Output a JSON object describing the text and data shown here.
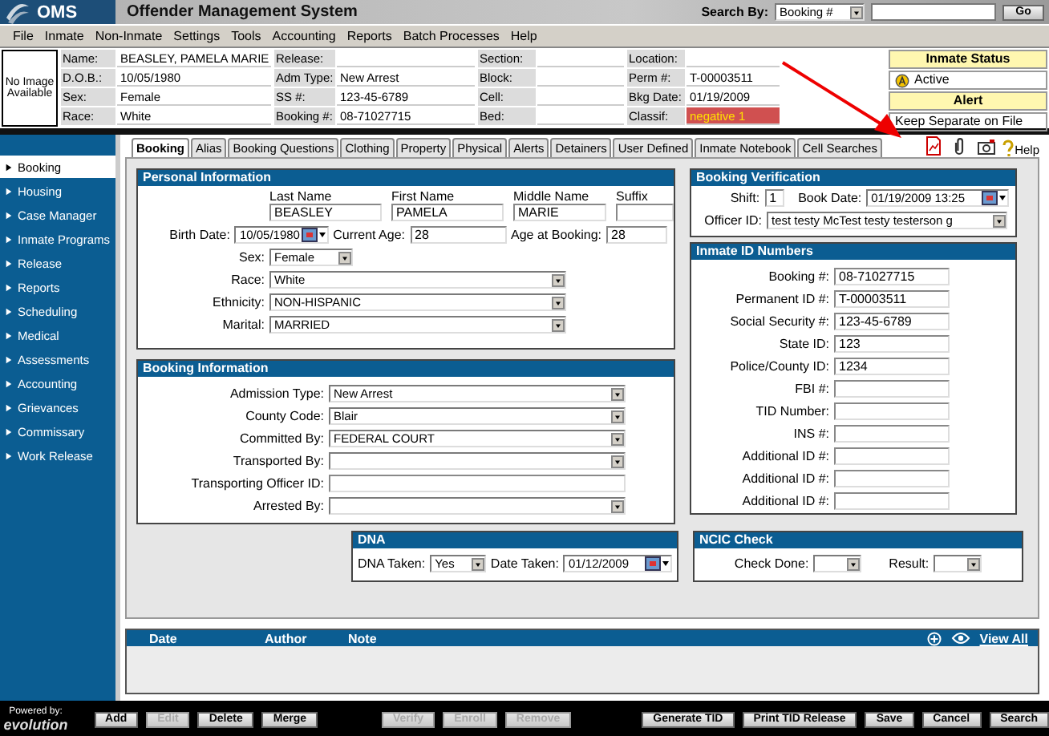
{
  "app": {
    "logo": "OMS",
    "title": "Offender Management System"
  },
  "search": {
    "label": "Search By:",
    "option": "Booking #",
    "button": "Go"
  },
  "menu": [
    "File",
    "Inmate",
    "Non-Inmate",
    "Settings",
    "Tools",
    "Accounting",
    "Reports",
    "Batch Processes",
    "Help"
  ],
  "inmate_header": {
    "photo_text": "No Image Available",
    "columns": [
      [
        {
          "label": "Name:",
          "value": "BEASLEY, PAMELA MARIE",
          "flagged": false
        },
        {
          "label": "D.O.B.:",
          "value": "10/05/1980",
          "flagged": false
        },
        {
          "label": "Sex:",
          "value": "Female",
          "flagged": false
        },
        {
          "label": "Race:",
          "value": "White",
          "flagged": false
        }
      ],
      [
        {
          "label": "Release:",
          "flagged": false
        },
        {
          "label": "Adm Type:",
          "value": "New Arrest",
          "flagged": false
        },
        {
          "label": "SS #:",
          "value": "123-45-6789",
          "flagged": false
        },
        {
          "label": "Booking #:",
          "value": "08-71027715",
          "flagged": false
        }
      ],
      [
        {
          "label": "Section:",
          "flagged": false
        },
        {
          "label": "Block:",
          "flagged": false
        },
        {
          "label": "Cell:",
          "flagged": false
        },
        {
          "label": "Bed:",
          "flagged": false
        }
      ],
      [
        {
          "label": "Location:",
          "flagged": false
        },
        {
          "label": "Perm #:",
          "value": "T-00003511",
          "flagged": false
        },
        {
          "label": "Bkg Date:",
          "value": "01/19/2009",
          "flagged": false
        },
        {
          "label": "Classif:",
          "value": "negative 1",
          "flagged": true
        }
      ]
    ]
  },
  "status_panel": {
    "title": "Inmate Status",
    "status": "Active",
    "alert_title": "Alert",
    "alert": "Keep Separate on File"
  },
  "sidebar": [
    {
      "label": "Booking",
      "selected": true
    },
    {
      "label": "Housing",
      "selected": false
    },
    {
      "label": "Case Manager",
      "selected": false
    },
    {
      "label": "Inmate Programs",
      "selected": false
    },
    {
      "label": "Release",
      "selected": false
    },
    {
      "label": "Reports",
      "selected": false
    },
    {
      "label": "Scheduling",
      "selected": false
    },
    {
      "label": "Medical",
      "selected": false
    },
    {
      "label": "Assessments",
      "selected": false
    },
    {
      "label": "Accounting",
      "selected": false
    },
    {
      "label": "Grievances",
      "selected": false
    },
    {
      "label": "Commissary",
      "selected": false
    },
    {
      "label": "Work Release",
      "selected": false
    }
  ],
  "tabs": [
    {
      "label": "Booking",
      "selected": true
    },
    {
      "label": "Alias",
      "selected": false
    },
    {
      "label": "Booking Questions",
      "selected": false
    },
    {
      "label": "Clothing",
      "selected": false
    },
    {
      "label": "Property",
      "selected": false
    },
    {
      "label": "Physical",
      "selected": false
    },
    {
      "label": "Alerts",
      "selected": false
    },
    {
      "label": "Detainers",
      "selected": false
    },
    {
      "label": "User Defined",
      "selected": false
    },
    {
      "label": "Inmate Notebook",
      "selected": false
    },
    {
      "label": "Cell Searches",
      "selected": false
    }
  ],
  "help": "Help",
  "personal_information": {
    "title": "Personal Information",
    "names": [
      {
        "label": "Last Name",
        "value": "BEASLEY"
      },
      {
        "label": "First Name",
        "value": "PAMELA"
      },
      {
        "label": "Middle Name",
        "value": "MARIE"
      },
      {
        "label": "Suffix"
      }
    ],
    "birth_date": {
      "label": "Birth Date:",
      "value": "10/05/1980"
    },
    "current_age": {
      "label": "Current Age:",
      "value": "28"
    },
    "age_at_booking": {
      "label": "Age at Booking:",
      "value": "28"
    },
    "sex": {
      "label": "Sex:",
      "value": "Female"
    },
    "selects": [
      {
        "label": "Race:",
        "value": "White"
      },
      {
        "label": "Ethnicity:",
        "value": "NON-HISPANIC"
      },
      {
        "label": "Marital:",
        "value": "MARRIED"
      }
    ]
  },
  "booking_information": {
    "title": "Booking Information",
    "fields": [
      {
        "label": "Admission Type:",
        "value": "New Arrest",
        "kind": "select"
      },
      {
        "label": "County Code:",
        "value": "Blair",
        "kind": "select"
      },
      {
        "label": "Committed By:",
        "value": "FEDERAL COURT",
        "kind": "select"
      },
      {
        "label": "Transported By:",
        "kind": "select"
      },
      {
        "label": "Transporting Officer ID:",
        "kind": "text"
      },
      {
        "label": "Arrested By:",
        "kind": "select"
      }
    ]
  },
  "booking_verification": {
    "title": "Booking Verification",
    "shift": {
      "label": "Shift:",
      "value": "1"
    },
    "book_date": {
      "label": "Book Date:",
      "value": "01/19/2009 13:25"
    },
    "officer": {
      "label": "Officer ID:",
      "value": "test testy McTest testy testerson g"
    }
  },
  "inmate_id_numbers": {
    "title": "Inmate ID Numbers",
    "fields": [
      {
        "label": "Booking #:",
        "value": "08-71027715"
      },
      {
        "label": "Permanent ID #:",
        "value": "T-00003511"
      },
      {
        "label": "Social Security #:",
        "value": "123-45-6789"
      },
      {
        "label": "State ID:",
        "value": "123"
      },
      {
        "label": "Police/County ID:",
        "value": "1234"
      },
      {
        "label": "FBI #:"
      },
      {
        "label": "TID Number:"
      },
      {
        "label": "INS #:"
      },
      {
        "label": "Additional ID #:"
      },
      {
        "label": "Additional ID #:"
      },
      {
        "label": "Additional ID #:"
      }
    ]
  },
  "dna": {
    "title": "DNA",
    "taken": {
      "label": "DNA Taken:",
      "value": "Yes"
    },
    "date": {
      "label": "Date Taken:",
      "value": "01/12/2009"
    }
  },
  "ncic_check": {
    "title": "NCIC Check",
    "check_done": {
      "label": "Check Done:"
    },
    "result": {
      "label": "Result:"
    }
  },
  "notes": {
    "columns": [
      "Date",
      "Author",
      "Note"
    ],
    "view_all": "View All"
  },
  "footer": {
    "powered_by": "Powered by:",
    "brand": "evolution"
  },
  "buttons": [
    {
      "label": "Add",
      "disabled": false
    },
    {
      "label": "Edit",
      "disabled": true
    },
    {
      "label": "Delete",
      "disabled": false
    },
    {
      "label": "Merge",
      "disabled": false
    },
    {
      "label": "Verify",
      "disabled": true
    },
    {
      "label": "Enroll",
      "disabled": true
    },
    {
      "label": "Remove",
      "disabled": true
    },
    {
      "label": "Generate TID",
      "disabled": false
    },
    {
      "label": "Print TID Release",
      "disabled": false
    },
    {
      "label": "Save",
      "disabled": false
    },
    {
      "label": "Cancel",
      "disabled": false
    },
    {
      "label": "Search",
      "disabled": false
    }
  ]
}
